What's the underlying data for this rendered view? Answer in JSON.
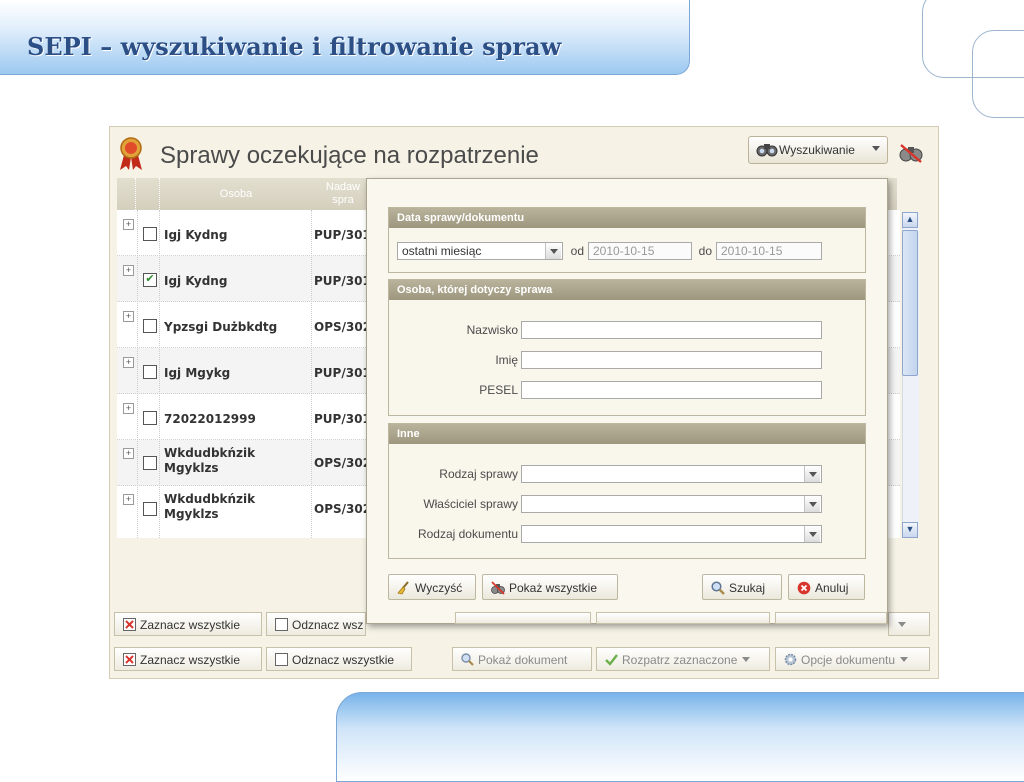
{
  "slide": {
    "title": "SEPI – wyszukiwanie i filtrowanie spraw"
  },
  "panel": {
    "title": "Sprawy oczekujące na rozpatrzenie",
    "search_button": "Wyszukiwanie",
    "icons": {
      "title": "award-ribbon-icon",
      "search": "binoculars-icon",
      "reset": "binoculars-clear-icon"
    }
  },
  "grid": {
    "columns": [
      {
        "label": "Osoba"
      },
      {
        "label": "Nadaw\nspra"
      }
    ],
    "rows": [
      {
        "name": "Igj Kydng",
        "code": "PUP/301",
        "checked": false
      },
      {
        "name": "Igj Kydng",
        "code": "PUP/301",
        "checked": true
      },
      {
        "name": "Ypzsgi Dużbkdtg",
        "code": "OPS/302",
        "checked": false
      },
      {
        "name": "Igj Mgykg",
        "code": "PUP/301",
        "checked": false
      },
      {
        "name": "72022012999",
        "code": "PUP/301",
        "checked": false
      },
      {
        "name": "Wkdudbkńzik Mgyklzs",
        "code": "OPS/302",
        "checked": false
      },
      {
        "name": "Wkdudbkńzik Mgyklzs",
        "code": "OPS/302",
        "checked": false
      }
    ],
    "check_mark": "✔"
  },
  "toolbar": {
    "select_all": "Zaznacz wszystkie",
    "deselect_all": "Odznacz wszystkie",
    "show_document": "Pokaż dokument",
    "process_selected": "Rozpatrz zaznaczone",
    "document_options": "Opcje dokumentu",
    "ghost_select_all": "Zaznacz wszystkie",
    "ghost_deselect_all": "Odznacz wsz",
    "ghost_process": "Rozpatrz zaznaczone",
    "ghost_options": "Opcje dokumentu"
  },
  "filter": {
    "section_date": {
      "title": "Data sprawy/dokumentu",
      "period_value": "ostatni miesiąc",
      "from_label": "od",
      "from_value": "2010-10-15",
      "to_label": "do",
      "to_value": "2010-10-15"
    },
    "section_person": {
      "title": "Osoba, której dotyczy sprawa",
      "surname_label": "Nazwisko",
      "surname_value": "",
      "firstname_label": "Imię",
      "firstname_value": "",
      "pesel_label": "PESEL",
      "pesel_value": ""
    },
    "section_other": {
      "title": "Inne",
      "case_type_label": "Rodzaj sprawy",
      "case_type_value": "",
      "owner_label": "Właściciel sprawy",
      "owner_value": "",
      "doc_type_label": "Rodzaj dokumentu",
      "doc_type_value": ""
    },
    "buttons": {
      "clear": "Wyczyść",
      "show_all": "Pokaż wszystkie",
      "search": "Szukaj",
      "cancel": "Anuluj"
    }
  },
  "colors": {
    "title_blue": "#2c4f86",
    "header_tan": "#d4cfbd",
    "section_tan": "#9e977e",
    "cancel_red": "#d9342b",
    "check_green": "#2e8b2e"
  }
}
